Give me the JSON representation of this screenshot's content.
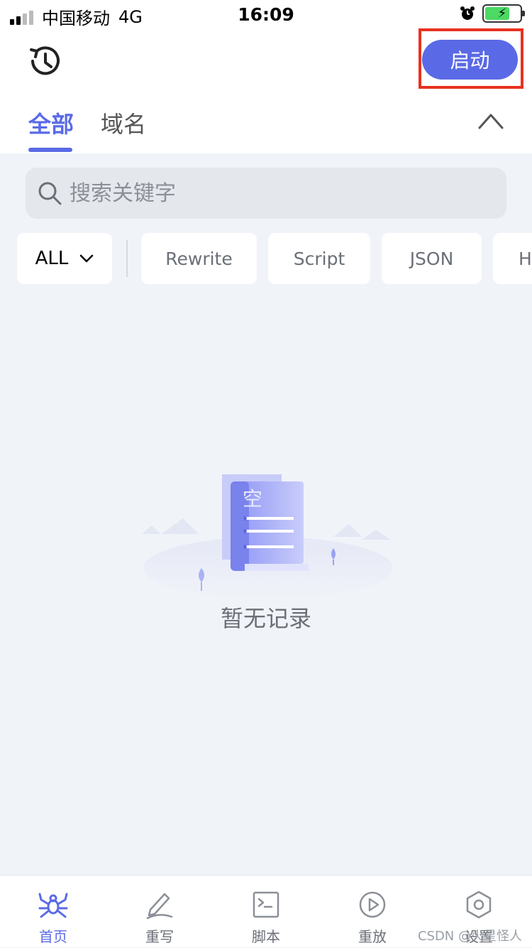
{
  "status": {
    "carrier": "中国移动",
    "network": "4G",
    "time": "16:09"
  },
  "header": {
    "start_label": "启动",
    "tabs": [
      {
        "label": "全部",
        "active": true
      },
      {
        "label": "域名",
        "active": false
      }
    ]
  },
  "search": {
    "placeholder": "搜索关键字"
  },
  "filters": {
    "selected": "ALL",
    "chips": [
      "Rewrite",
      "Script",
      "JSON",
      "H"
    ]
  },
  "empty": {
    "message": "暂无记录",
    "illustration_text": "空"
  },
  "tabbar": {
    "items": [
      {
        "label": "首页",
        "icon": "spider-icon",
        "active": true
      },
      {
        "label": "重写",
        "icon": "pen-icon",
        "active": false
      },
      {
        "label": "脚本",
        "icon": "terminal-icon",
        "active": false
      },
      {
        "label": "重放",
        "icon": "play-icon",
        "active": false
      },
      {
        "label": "设置",
        "icon": "hexagon-gear-icon",
        "active": false
      }
    ]
  },
  "watermark": "CSDN @火星怪人",
  "colors": {
    "accent": "#5a6ae6",
    "highlight": "#e8321f",
    "background": "#f0f3f8"
  }
}
